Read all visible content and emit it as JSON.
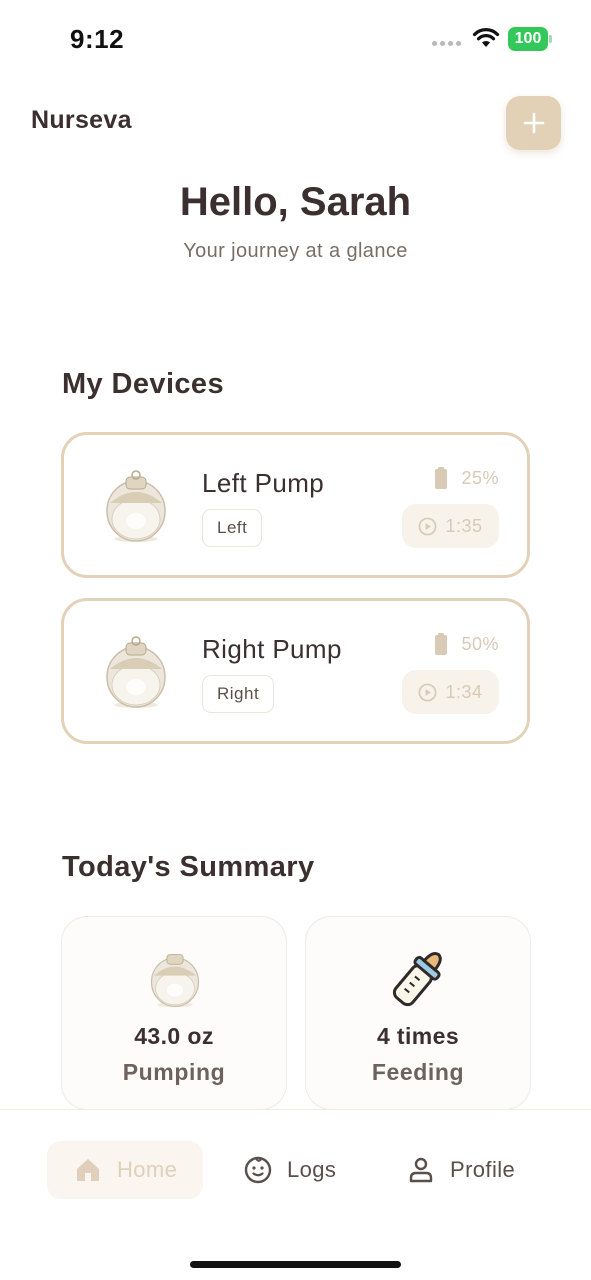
{
  "status_bar": {
    "time": "9:12",
    "battery": "100"
  },
  "header": {
    "brand": "Nurseva",
    "add_icon": "plus-icon"
  },
  "greeting": {
    "title": "Hello, Sarah",
    "subtitle": "Your journey at a glance"
  },
  "devices": {
    "title": "My Devices",
    "items": [
      {
        "name": "Left Pump",
        "side": "Left",
        "battery": "25%",
        "timer": "1:35",
        "battery_level": 0.25
      },
      {
        "name": "Right Pump",
        "side": "Right",
        "battery": "50%",
        "timer": "1:34",
        "battery_level": 0.5
      }
    ]
  },
  "summary": {
    "title": "Today's Summary",
    "cards": [
      {
        "value": "43.0 oz",
        "label": "Pumping",
        "icon": "pump-icon"
      },
      {
        "value": "4 times",
        "label": "Feeding",
        "icon": "baby-bottle-icon"
      }
    ]
  },
  "nav": {
    "items": [
      {
        "label": "Home",
        "icon": "home-icon",
        "active": true
      },
      {
        "label": "Logs",
        "icon": "baby-face-icon",
        "active": false
      },
      {
        "label": "Profile",
        "icon": "person-icon",
        "active": false
      }
    ]
  },
  "colors": {
    "accent": "#e2d1b6",
    "border": "#e3d1b8",
    "text": "#3b2f2f",
    "muted": "#d8cab5"
  }
}
